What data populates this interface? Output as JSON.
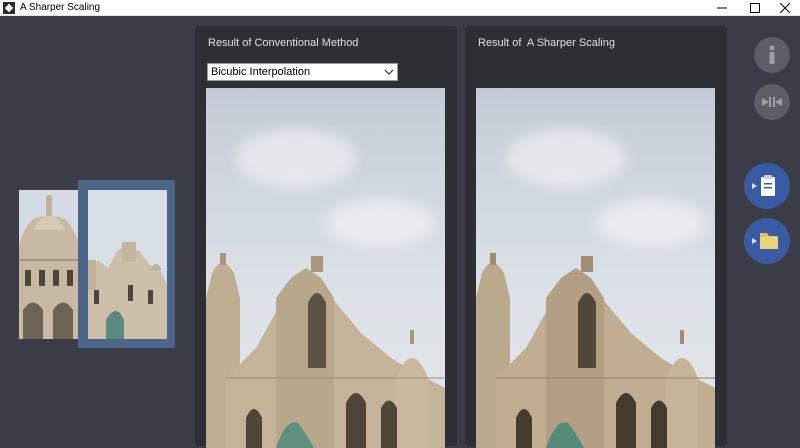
{
  "window": {
    "title": "A Sharper Scaling",
    "controls": [
      "—",
      "☐",
      "✕"
    ]
  },
  "left_panel": {
    "title": "Result of Conventional Method",
    "method_select": {
      "selected": "Bicubic Interpolation"
    }
  },
  "right_panel": {
    "title": "Result of  A Sharper Scaling"
  },
  "sidebar": {
    "buttons": [
      {
        "name": "info",
        "icon": "info-icon",
        "color": "#5c5e66"
      },
      {
        "name": "compare",
        "icon": "compare-icon",
        "color": "#5c5e66"
      },
      {
        "name": "paste-clipboard",
        "icon": "clipboard-icon",
        "color": "#3a5ba3"
      },
      {
        "name": "open-folder",
        "icon": "folder-icon",
        "color": "#3a5ba3"
      }
    ]
  },
  "colors": {
    "background": "#3a3d47",
    "panel": "#2e2f35",
    "accent": "#3a5ba3",
    "selection_frame": "#4d6688"
  }
}
